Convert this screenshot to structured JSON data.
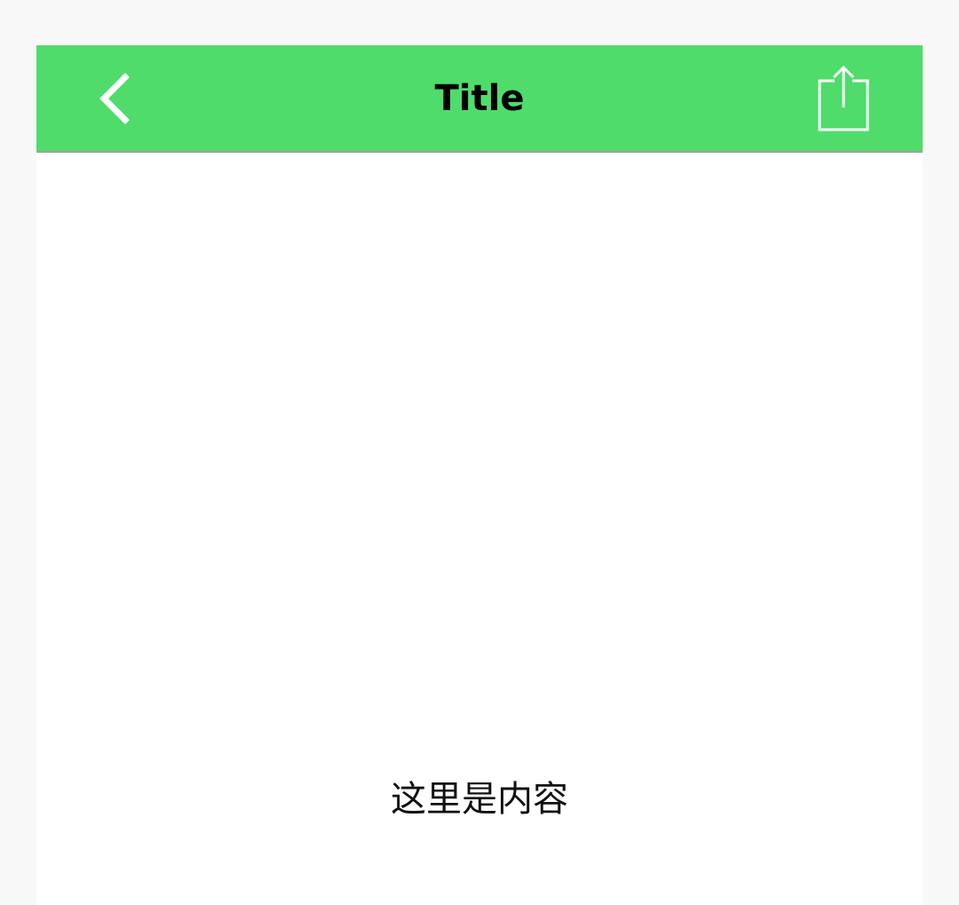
{
  "colors": {
    "app_bar_background": "#4fdc6b",
    "app_bar_icon": "#ffffff",
    "title_text": "#000000",
    "page_background": "#f8f8f8",
    "content_background": "#ffffff"
  },
  "app_bar": {
    "title": "Title",
    "left_icon": "back-chevron-icon",
    "right_icon": "share-icon"
  },
  "content": {
    "text": "这里是内容"
  }
}
